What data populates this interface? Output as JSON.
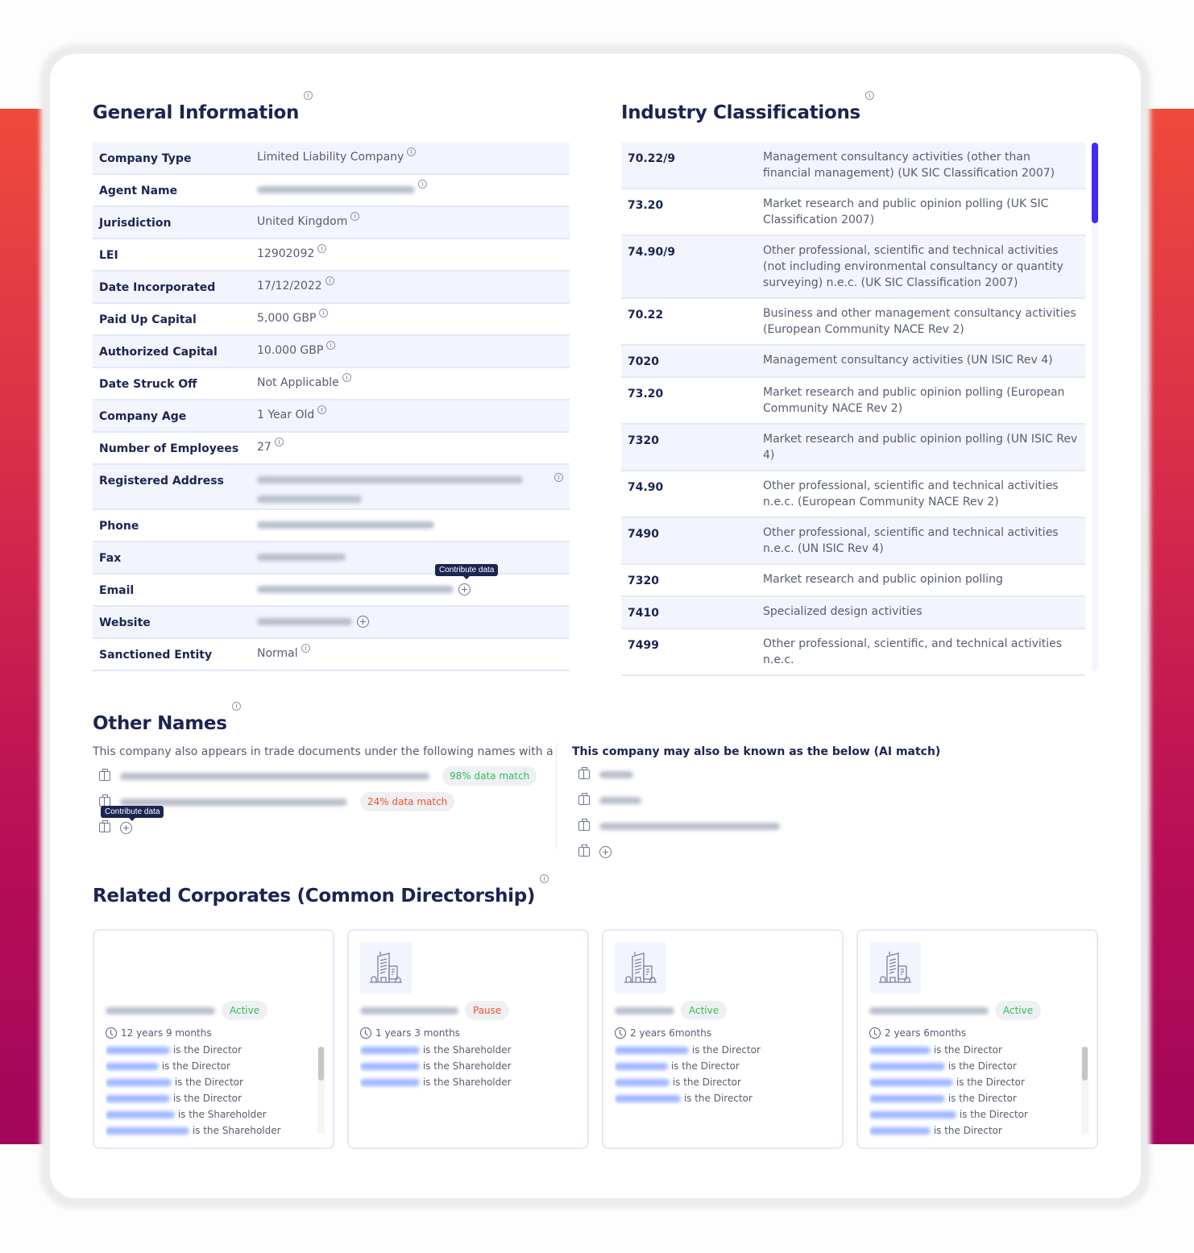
{
  "general_info": {
    "title": "General Information",
    "rows": [
      {
        "label": "Company Type",
        "value": "Limited Liability Company",
        "icon": "info-icon"
      },
      {
        "label": "Agent Name",
        "value": "[redacted]",
        "icon": "info-icon",
        "redacted": true
      },
      {
        "label": "Jurisdiction",
        "value": "United Kingdom",
        "icon": "info-icon"
      },
      {
        "label": "LEI",
        "value": "12902092",
        "icon": "info-icon"
      },
      {
        "label": "Date Incorporated",
        "value": "17/12/2022",
        "icon": "info-icon"
      },
      {
        "label": "Paid Up Capital",
        "value": "5,000 GBP",
        "icon": "info-icon"
      },
      {
        "label": "Authorized Capital",
        "value": "10.000 GBP",
        "icon": "info-icon"
      },
      {
        "label": "Date Struck Off",
        "value": "Not Applicable",
        "icon": "info-icon"
      },
      {
        "label": "Company Age",
        "value": "1 Year Old",
        "icon": "info-icon"
      },
      {
        "label": "Number of Employees",
        "value": "27",
        "icon": "info-icon"
      },
      {
        "label": "Registered Address",
        "value": "[redacted]",
        "icon": "info-icon",
        "redacted": true
      },
      {
        "label": "Phone",
        "value": "[redacted]",
        "redacted": true
      },
      {
        "label": "Fax",
        "value": "[redacted]",
        "redacted": true
      },
      {
        "label": "Email",
        "value": "[redacted]",
        "icon": "plus-circle-icon",
        "redacted": true
      },
      {
        "label": "Website",
        "value": "[redacted]",
        "icon": "plus-circle-icon",
        "redacted": true
      },
      {
        "label": "Sanctioned Entity",
        "value": "Normal",
        "icon": "info-icon"
      }
    ],
    "tooltip": "Contribute data"
  },
  "industry": {
    "title": "Industry Classifications",
    "rows": [
      {
        "code": "70.22/9",
        "description": "Management consultancy activities (other than financial management) (UK SIC Classification 2007)"
      },
      {
        "code": "73.20",
        "description": "Market research and public opinion polling (UK SIC Classification 2007)"
      },
      {
        "code": "74.90/9",
        "description": "Other professional, scientific and technical activities (not including environmental consultancy or quantity surveying) n.e.c. (UK SIC Classification 2007)"
      },
      {
        "code": "70.22",
        "description": "Business and other management consultancy activities (European Community NACE Rev 2)"
      },
      {
        "code": "7020",
        "description": "Management consultancy activities (UN ISIC Rev 4)"
      },
      {
        "code": "73.20",
        "description": "Market research and public opinion polling (European Community NACE Rev 2)"
      },
      {
        "code": "7320",
        "description": "Market research and public opinion polling (UN ISIC Rev 4)"
      },
      {
        "code": "74.90",
        "description": "Other professional, scientific and technical activities n.e.c. (European Community NACE Rev 2)"
      },
      {
        "code": "7490",
        "description": "Other professional, scientific and technical activities n.e.c. (UN ISIC Rev 4)"
      },
      {
        "code": "7320",
        "description": "Market research and public opinion polling"
      },
      {
        "code": "7410",
        "description": "Specialized design activities"
      },
      {
        "code": "7499",
        "description": "Other professional, scientific, and technical activities n.e.c."
      }
    ]
  },
  "other_names": {
    "title": "Other Names",
    "description": "This company also appears in trade documents under the following names with a",
    "trade_names": [
      {
        "name": "[redacted]",
        "match": "98% data match",
        "match_color": "#2fbf5a"
      },
      {
        "name": "[redacted]",
        "match": "24% data match",
        "match_color": "#f0512b"
      }
    ],
    "tooltip": "Contribute data",
    "ai_title": "This company may also be known as the below (AI match)",
    "ai_names": [
      "[redacted]",
      "[redacted]",
      "[redacted]"
    ]
  },
  "related": {
    "title": "Related Corporates (Common Directorship)",
    "cards": [
      {
        "name": "[redacted]",
        "status": "Active",
        "status_color": "#2fbf5a",
        "age": "12 years 9 months",
        "has_logo": false,
        "people": [
          "is the Director",
          "is the Director",
          "is the Director",
          "is the Director",
          "is the Shareholder",
          "is the Shareholder"
        ],
        "scroll": true
      },
      {
        "name": "[redacted]",
        "status": "Pause",
        "status_color": "#f0512b",
        "age": "1 years 3 months",
        "has_logo": true,
        "people": [
          "is the Shareholder",
          "is the Shareholder",
          "is the Shareholder"
        ],
        "scroll": false
      },
      {
        "name": "[redacted]",
        "status": "Active",
        "status_color": "#2fbf5a",
        "age": "2 years 6months",
        "has_logo": true,
        "people": [
          "is the Director",
          "is the Director",
          "is the Director",
          "is the Director"
        ],
        "scroll": false
      },
      {
        "name": "[redacted]",
        "status": "Active",
        "status_color": "#2fbf5a",
        "age": "2 years 6months",
        "has_logo": true,
        "people": [
          "is the Director",
          "is the Director",
          "is the Director",
          "is the Director",
          "is the Director",
          "is the Director"
        ],
        "scroll": true
      }
    ]
  },
  "colors": {
    "accent": "#3d2cf5",
    "heading": "#1b2452",
    "band_top": "#ef4a3c",
    "band_bottom": "#a3055a"
  }
}
